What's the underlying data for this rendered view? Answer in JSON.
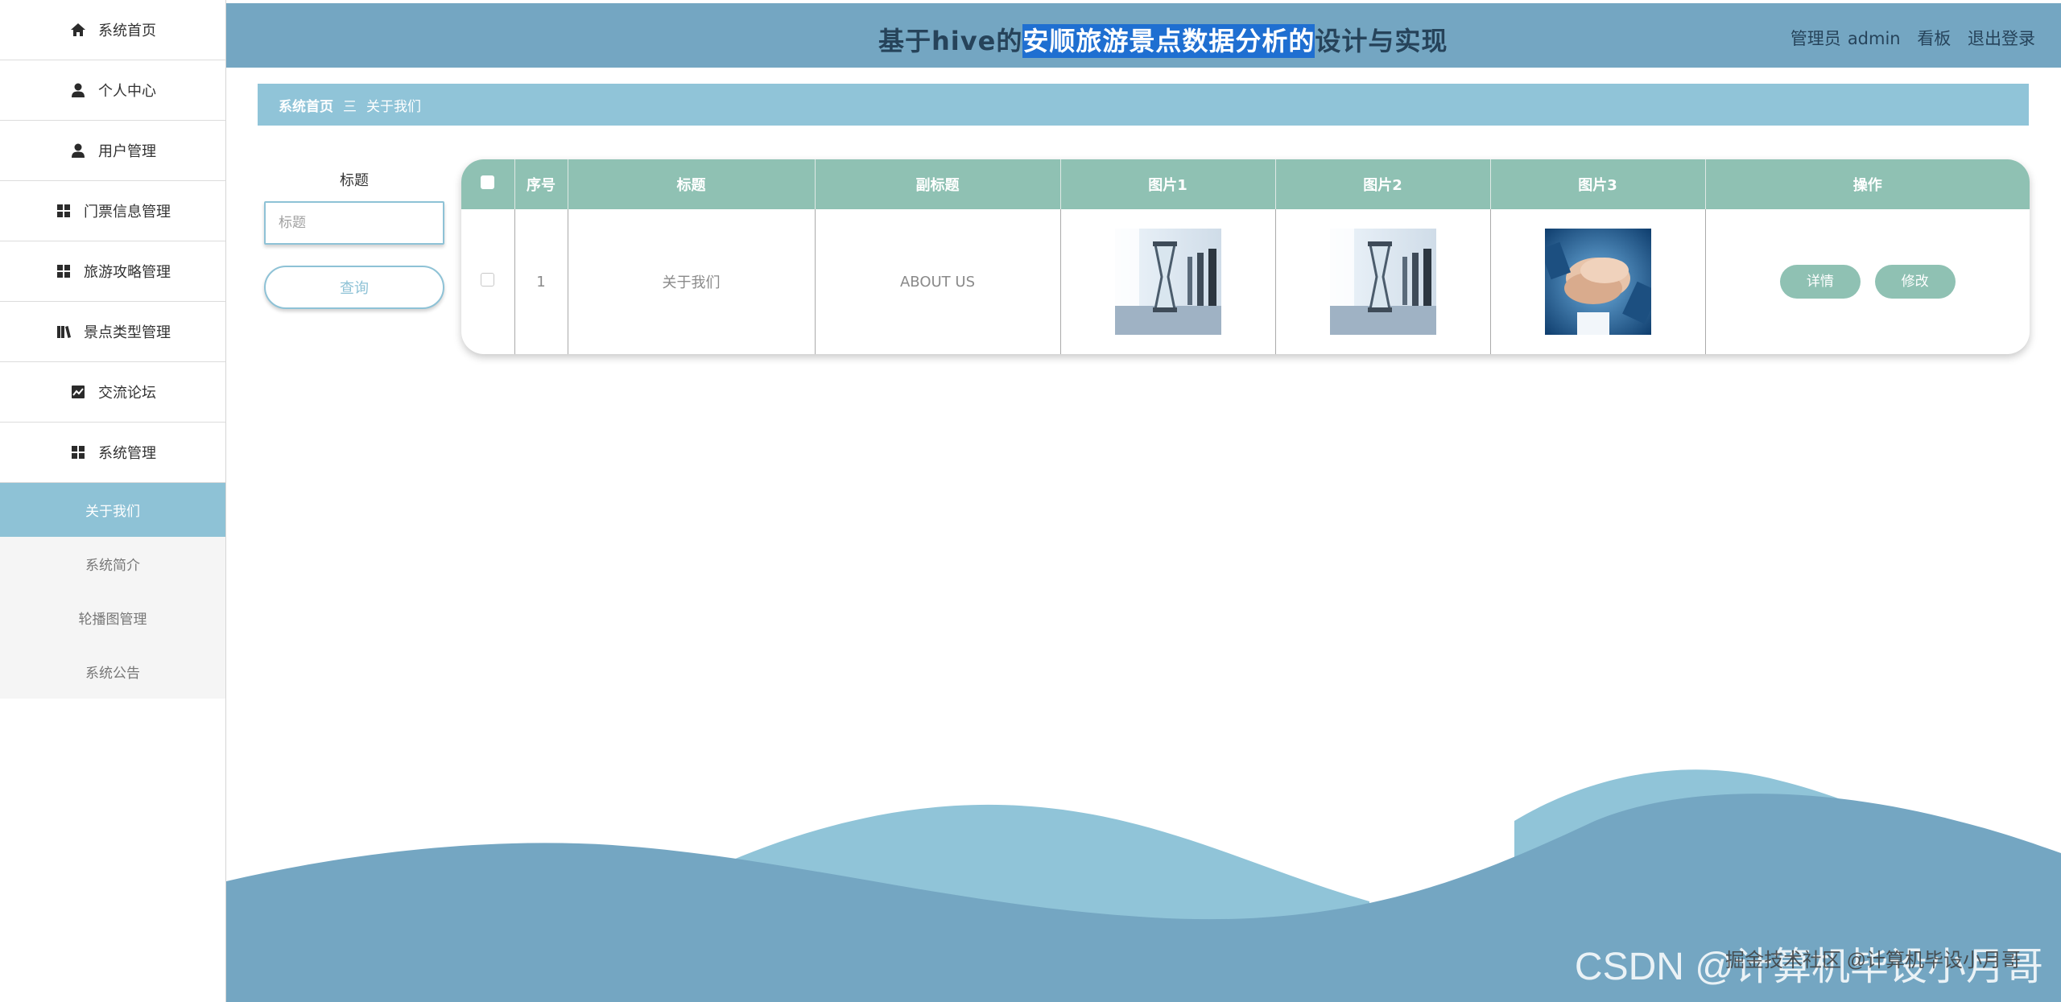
{
  "header": {
    "title_prefix": "基于hive的",
    "title_selected": "安顺旅游景点数据分析的",
    "title_suffix": "设计与实现",
    "user_role": "管理员",
    "username": "admin",
    "dashboard": "看板",
    "logout": "退出登录"
  },
  "sidebar": {
    "items": [
      {
        "label": "系统首页",
        "icon": "home-icon"
      },
      {
        "label": "个人中心",
        "icon": "user-icon"
      },
      {
        "label": "用户管理",
        "icon": "user-icon"
      },
      {
        "label": "门票信息管理",
        "icon": "grid-icon"
      },
      {
        "label": "旅游攻略管理",
        "icon": "grid-icon"
      },
      {
        "label": "景点类型管理",
        "icon": "library-icon"
      },
      {
        "label": "交流论坛",
        "icon": "chart-icon"
      },
      {
        "label": "系统管理",
        "icon": "grid-icon"
      }
    ],
    "sub_items": [
      {
        "label": "关于我们",
        "active": true
      },
      {
        "label": "系统简介",
        "active": false
      },
      {
        "label": "轮播图管理",
        "active": false
      },
      {
        "label": "系统公告",
        "active": false
      }
    ]
  },
  "breadcrumb": {
    "home": "系统首页",
    "separator": "三",
    "current": "关于我们"
  },
  "search": {
    "label": "标题",
    "placeholder": "标题",
    "value": "",
    "button": "查询"
  },
  "table": {
    "columns": [
      "序号",
      "标题",
      "副标题",
      "图片1",
      "图片2",
      "图片3",
      "操作"
    ],
    "rows": [
      {
        "index": "1",
        "title": "关于我们",
        "subtitle": "ABOUT US",
        "image1": "hourglass-office-image",
        "image2": "hourglass-office-image",
        "image3": "stacked-hands-image",
        "actions": [
          "详情",
          "修改"
        ]
      }
    ]
  },
  "watermark": {
    "main": "CSDN @计算机毕设小月哥",
    "overlay": "掘金技术社区 @计算机毕设小月哥"
  },
  "colors": {
    "header_bg": "#74a6c2",
    "breadcrumb_bg": "#90c4d8",
    "table_header_bg": "#8fc1b3",
    "active_sub_bg": "#8ec2d6",
    "wave_dark": "#74a6c2",
    "wave_light": "#90c4d8"
  }
}
